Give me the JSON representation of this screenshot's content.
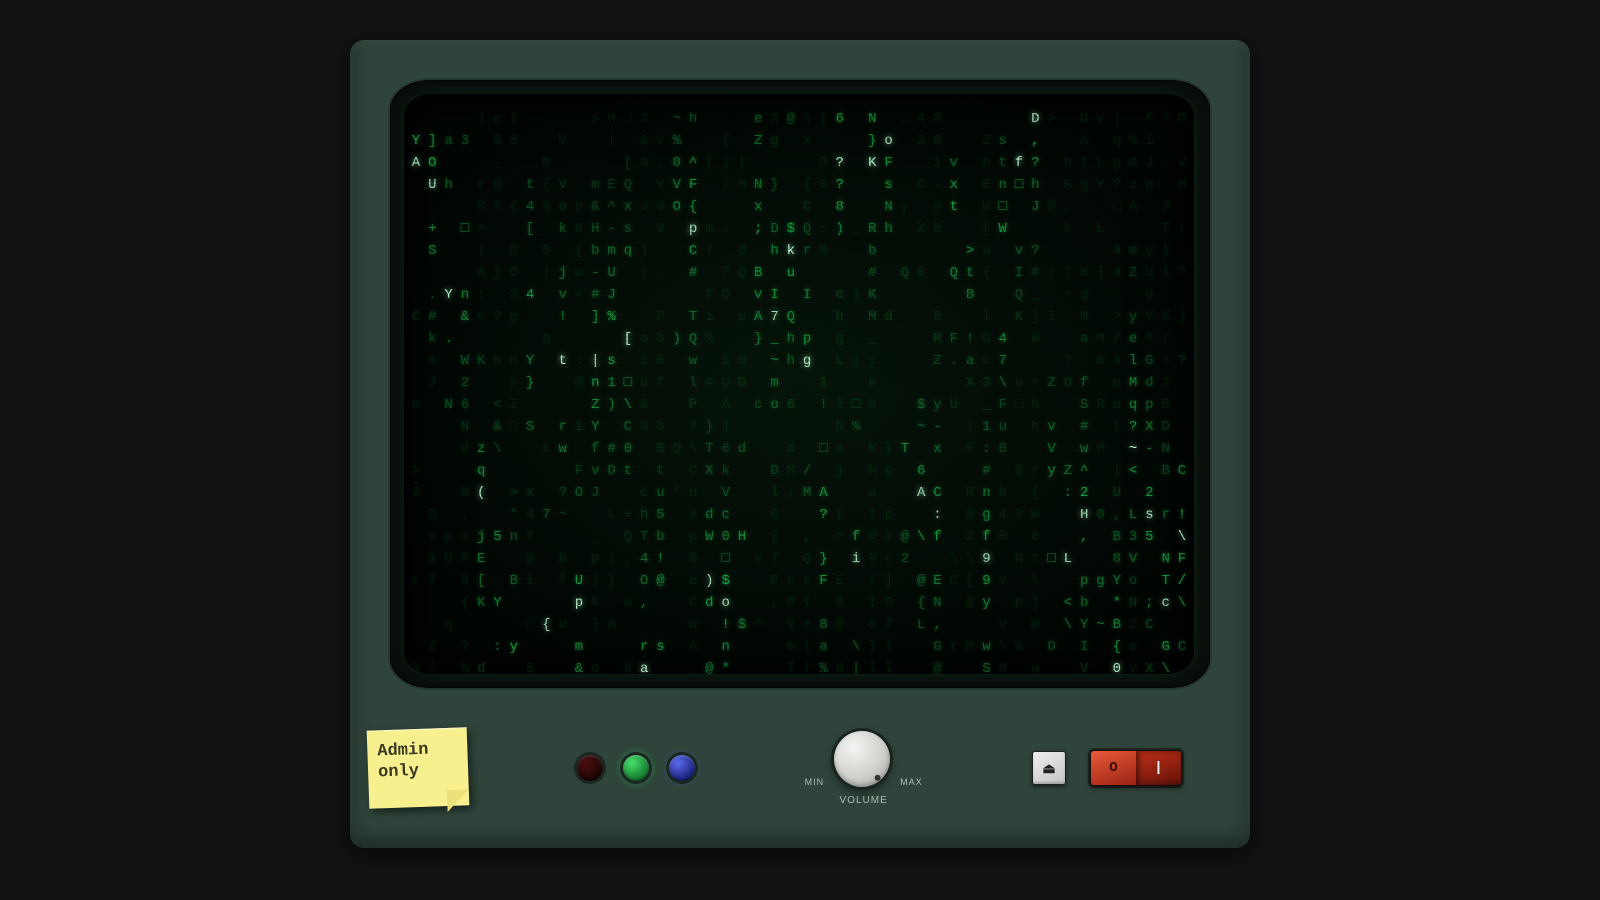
{
  "sticky_note": {
    "line1": "Admin",
    "line2": "only"
  },
  "leds": [
    {
      "color": "red",
      "on": false
    },
    {
      "color": "green",
      "on": true
    },
    {
      "color": "blue",
      "on": true
    }
  ],
  "knob": {
    "min_label": "MIN",
    "max_label": "MAX",
    "label": "VOLUME"
  },
  "eject_glyph": "⏏",
  "rocker": {
    "off_label": "O",
    "on_label": "|"
  },
  "screen": {
    "cols": 48,
    "rows": 26,
    "charset": "0123456789ABCDEFGHIJKLMNOPQRSTUVWXYZabcdefghijklmnopqrstuvwxyz!?#$%&(){}[]<>^~@+-*/.:,;_|\\□",
    "seed": 42
  }
}
